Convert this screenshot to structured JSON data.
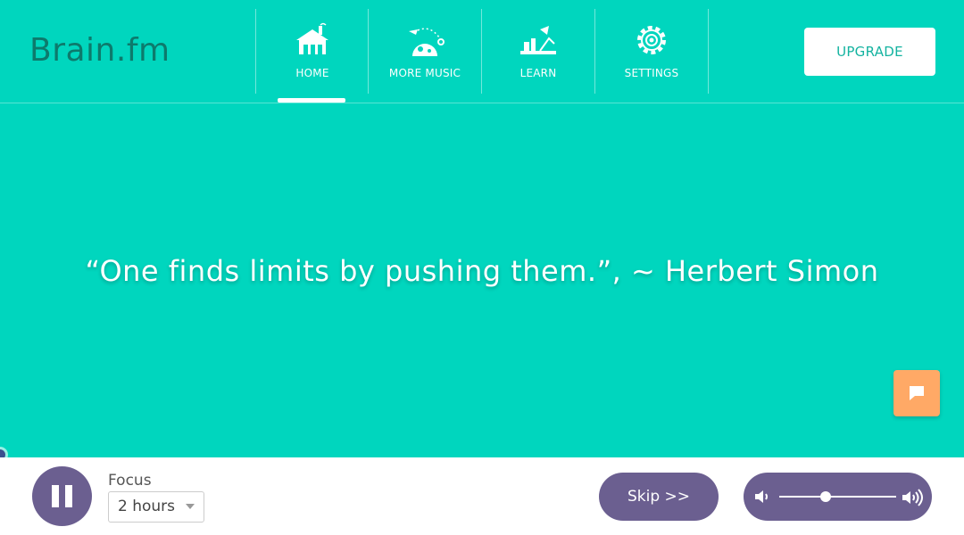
{
  "app": {
    "logo": "Brain.fm"
  },
  "nav": {
    "items": [
      {
        "label": "HOME",
        "icon": "home-icon",
        "active": true
      },
      {
        "label": "MORE MUSIC",
        "icon": "music-icon",
        "active": false
      },
      {
        "label": "LEARN",
        "icon": "lamp-icon",
        "active": false
      },
      {
        "label": "SETTINGS",
        "icon": "gear-icon",
        "active": false
      }
    ],
    "upgrade_label": "UPGRADE"
  },
  "quote": {
    "text": "“One finds limits by pushing them.”, ~ Herbert Simon"
  },
  "player": {
    "mode_label": "Focus",
    "duration": "2 hours",
    "skip_label": "Skip >>",
    "volume_level": 0.4
  },
  "colors": {
    "background": "#00d6be",
    "logo": "#0d7a6c",
    "player_accent": "#6b5f90",
    "chat_button": "#ffa966"
  }
}
